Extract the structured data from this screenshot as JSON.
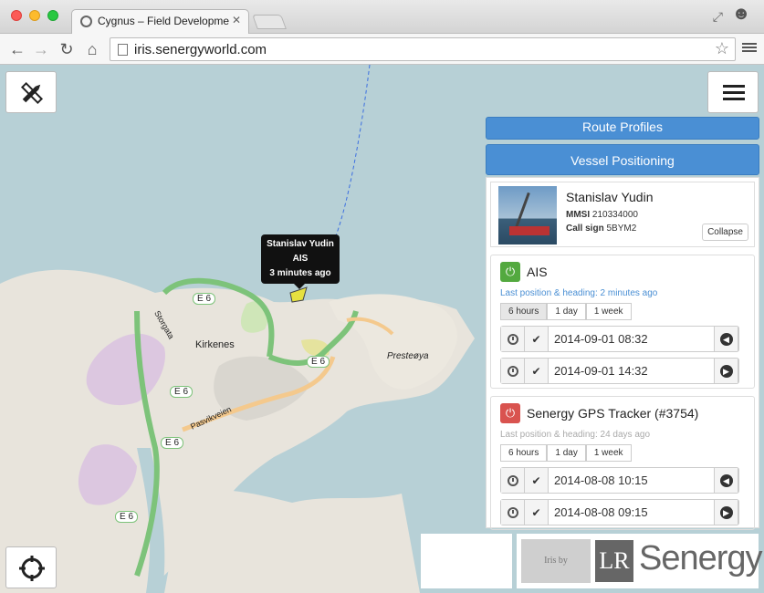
{
  "browser": {
    "tab_title": "Cygnus – Field Developme",
    "url": "iris.senergyworld.com",
    "tab_close": "✕",
    "back": "←",
    "forward": "→",
    "reload": "↻",
    "home": "⌂",
    "bookmark": "☆"
  },
  "map": {
    "tooltip": {
      "name": "Stanislav Yudin",
      "source": "AIS",
      "age": "3 minutes ago"
    },
    "labels": {
      "town": "Kirkenes",
      "island": "Presteøya",
      "road1": "E 6",
      "road2": "E 6",
      "road3": "E 6",
      "road4": "E 6",
      "road5": "E 6",
      "street1": "Storgata",
      "street2": "Pasvikveien"
    },
    "colors": {
      "water": "#b7d0d6",
      "land": "#e8e4dc",
      "road_green": "#7dc37a",
      "road_orange": "#f4c98d"
    }
  },
  "panel": {
    "route_profiles": "Route Profiles",
    "vessel_positioning": "Vessel Positioning",
    "vessel": {
      "name": "Stanislav Yudin",
      "mmsi_label": "MMSI",
      "mmsi": "210334000",
      "callsign_label": "Call sign",
      "callsign": "5BYM2",
      "collapse": "Collapse"
    },
    "feeds": [
      {
        "title": "AIS",
        "status": "on",
        "subtitle": "Last position & heading: 2 minutes ago",
        "ranges": [
          "6 hours",
          "1 day",
          "1 week"
        ],
        "active_range": "6 hours",
        "from": "2014-09-01 08:32",
        "to": "2014-09-01 14:32"
      },
      {
        "title": "Senergy GPS Tracker (#3754)",
        "status": "off",
        "subtitle": "Last position & heading: 24 days ago",
        "ranges": [
          "6 hours",
          "1 day",
          "1 week"
        ],
        "active_range": "",
        "from": "2014-08-08 10:15",
        "to": "2014-08-08 09:15"
      }
    ]
  },
  "branding": {
    "irisby": "Iris by",
    "lr": "LR",
    "senergy": "Senergy"
  }
}
